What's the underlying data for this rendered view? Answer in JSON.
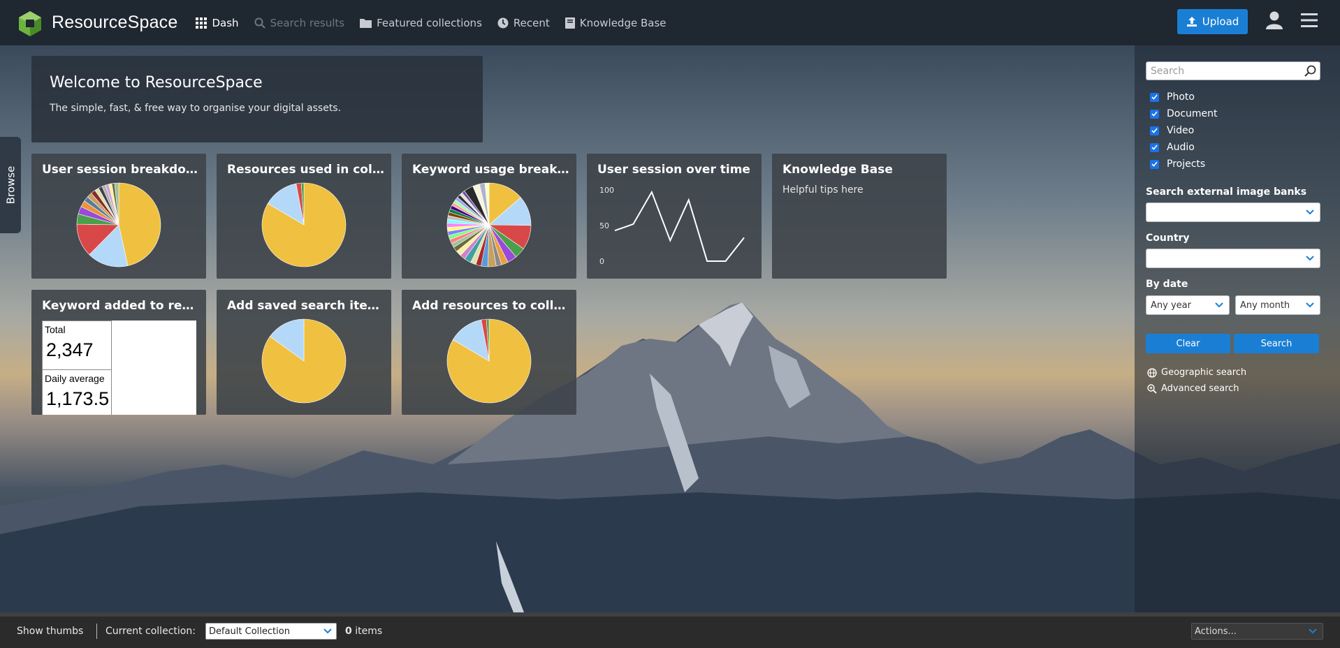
{
  "app": {
    "name": "ResourceSpace",
    "brand_color": "#6db33f",
    "accent_color": "#1a7fd4"
  },
  "nav": {
    "items": [
      {
        "label": "Dash",
        "icon": "grid-icon",
        "state": "active"
      },
      {
        "label": "Search results",
        "icon": "search-icon",
        "state": "disabled"
      },
      {
        "label": "Featured collections",
        "icon": "folder-icon",
        "state": "normal"
      },
      {
        "label": "Recent",
        "icon": "clock-icon",
        "state": "normal"
      },
      {
        "label": "Knowledge Base",
        "icon": "book-icon",
        "state": "normal"
      }
    ],
    "upload_label": "Upload"
  },
  "browse_tab": {
    "label": "Browse"
  },
  "welcome": {
    "title": "Welcome to ResourceSpace",
    "text": "The simple, fast, & free way to organise your digital assets."
  },
  "tiles": [
    {
      "title": "User session breakdown",
      "type": "pie"
    },
    {
      "title": "Resources used in coll...",
      "type": "pie"
    },
    {
      "title": "Keyword usage breakd...",
      "type": "pie"
    },
    {
      "title": "User session over time",
      "type": "line"
    },
    {
      "title": "Knowledge Base",
      "type": "text",
      "text": "Helpful tips here"
    },
    {
      "title": "Keyword added to res...",
      "type": "stats",
      "stats": [
        {
          "label": "Total",
          "value": "2,347"
        },
        {
          "label": "Daily average",
          "value": "1,173.5"
        }
      ]
    },
    {
      "title": "Add saved search item...",
      "type": "pie"
    },
    {
      "title": "Add resources to colle...",
      "type": "pie"
    }
  ],
  "chart_data": [
    {
      "type": "pie",
      "title": "User session breakdown",
      "values": [
        47,
        16,
        13,
        4,
        3,
        2.5,
        2,
        2,
        1.8,
        1.6,
        1.5,
        1.4,
        1.3,
        1.2,
        1.1,
        1.6
      ],
      "colors": [
        "#f0c040",
        "#b4d8f8",
        "#d94848",
        "#4aa04a",
        "#9a4ad8",
        "#e8943a",
        "#5a7a9a",
        "#c8a060",
        "#8a2a2a",
        "#e0e0b0",
        "#404050",
        "#b0b0b0",
        "#d0a0d0",
        "#f8f0a0",
        "#6a6a3a",
        "#a0c0a0"
      ]
    },
    {
      "type": "pie",
      "title": "Resources used in collections",
      "values": [
        83.5,
        13.5,
        2,
        1
      ],
      "colors": [
        "#f0c040",
        "#b4d8f8",
        "#d94848",
        "#4aa04a"
      ]
    },
    {
      "type": "pie",
      "title": "Keyword usage breakdown",
      "values": [
        13,
        11,
        9,
        4,
        3.5,
        2.5,
        2,
        3,
        2.5,
        2,
        2,
        2.5,
        2,
        2,
        1.8,
        1.6,
        1.6,
        1.5,
        1.5,
        1.5,
        1.5,
        1.4,
        1.4,
        1.3,
        1.3,
        1.3,
        1.2,
        1.2,
        1.2,
        1.2,
        1.1,
        1.1,
        3.5,
        2.5,
        2,
        1.5
      ],
      "colors": [
        "#f0c040",
        "#b4d8f8",
        "#d94848",
        "#4aa04a",
        "#9a4ad8",
        "#e8a040",
        "#8a8a8a",
        "#c8a060",
        "#5a9ad8",
        "#aa2a2a",
        "#e0e0b0",
        "#40a0a0",
        "#d080d0",
        "#f8f0a0",
        "#6a6a3a",
        "#a0c0a0",
        "#ff8080",
        "#80ff80",
        "#8080ff",
        "#ffff80",
        "#ff80ff",
        "#80ffff",
        "#c0c0c0",
        "#804000",
        "#008040",
        "#400080",
        "#ffa0a0",
        "#a0ffa0",
        "#a0a0ff",
        "#303030",
        "#e0e0e0",
        "#7050a0",
        "#2a2a2a",
        "#f5f5dc",
        "#b0b0d0",
        "#ffffc0"
      ]
    },
    {
      "type": "line",
      "title": "User session over time",
      "y": [
        43,
        52,
        97,
        29,
        86,
        0,
        0,
        33
      ],
      "ylim": [
        0,
        100
      ],
      "yticks": [
        "100",
        "50",
        "0"
      ]
    },
    {
      "type": "pie",
      "title": "Add saved search items",
      "values": [
        85,
        15
      ],
      "colors": [
        "#f0c040",
        "#b4d8f8"
      ]
    },
    {
      "type": "pie",
      "title": "Add resources to collections",
      "values": [
        83.5,
        13.5,
        2,
        1
      ],
      "colors": [
        "#f0c040",
        "#b4d8f8",
        "#d94848",
        "#4aa04a"
      ]
    }
  ],
  "sidebar": {
    "search_placeholder": "Search",
    "resource_types": [
      "Photo",
      "Document",
      "Video",
      "Audio",
      "Projects"
    ],
    "external_banks_label": "Search external image banks",
    "external_banks_value": "",
    "country_label": "Country",
    "country_value": "",
    "by_date_label": "By date",
    "year_value": "Any year",
    "month_value": "Any month",
    "clear_label": "Clear",
    "search_label": "Search",
    "geo_link": "Geographic search",
    "adv_link": "Advanced search"
  },
  "bottom": {
    "show_thumbs": "Show thumbs",
    "current_collection_label": "Current collection:",
    "collection_value": "Default Collection",
    "items_count": "0",
    "items_label": "items",
    "actions_value": "Actions..."
  }
}
